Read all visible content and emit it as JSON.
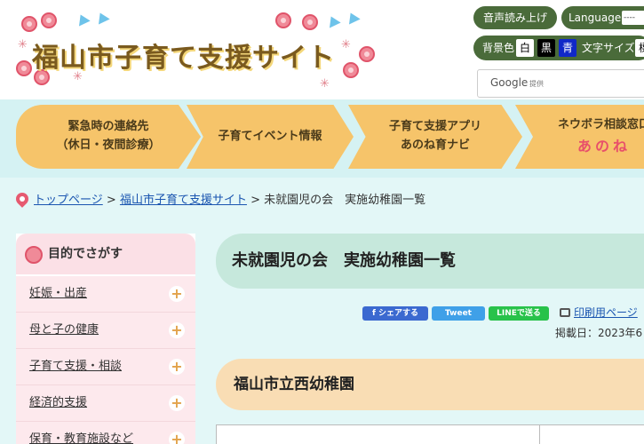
{
  "header": {
    "site_title": "福山市子育て支援サイト",
    "read_aloud_label": "音声読み上げ",
    "language_label": "Language",
    "language_value": "----",
    "bg_color_label": "背景色",
    "bg_options": [
      "白",
      "黒",
      "青"
    ],
    "text_size_label": "文字サイズ",
    "text_size_value": "標",
    "search_brand": "Google",
    "search_sub": "提供"
  },
  "nav": {
    "items": [
      {
        "label": "緊急時の連絡先\n（休日・夜間診療）"
      },
      {
        "label": "子育てイベント情報"
      },
      {
        "label": "子育て支援アプリ\nあのね育ナビ"
      },
      {
        "label": "ネウボラ相談窓口",
        "sub": "あのね"
      }
    ]
  },
  "breadcrumb": {
    "home": "トップページ",
    "sep": ">",
    "section": "福山市子育て支援サイト",
    "current": "未就園児の会　実施幼稚園一覧"
  },
  "sidebar": {
    "heading": "目的でさがす",
    "items": [
      {
        "label": "妊娠・出産"
      },
      {
        "label": "母と子の健康"
      },
      {
        "label": "子育て支援・相談"
      },
      {
        "label": "経済的支援"
      },
      {
        "label": "保育・教育施設など"
      }
    ]
  },
  "main": {
    "title": "未就園児の会　実施幼稚園一覧",
    "share": {
      "facebook": "f シェアする",
      "twitter": "Tweet",
      "line": "LINEで送る"
    },
    "print_label": "印刷用ページ",
    "posted": "掲載日：2023年6",
    "section_heading": "福山市立西幼稚園"
  },
  "colors": {
    "nav_bg": "#d5f2f3",
    "nav_item": "#f6c46a",
    "header_button": "#4a6b3a",
    "sidebar_head": "#fbe0e6",
    "title_bg": "#c6e8dc",
    "section_bg": "#f9ddb4",
    "link": "#1a55b0"
  }
}
